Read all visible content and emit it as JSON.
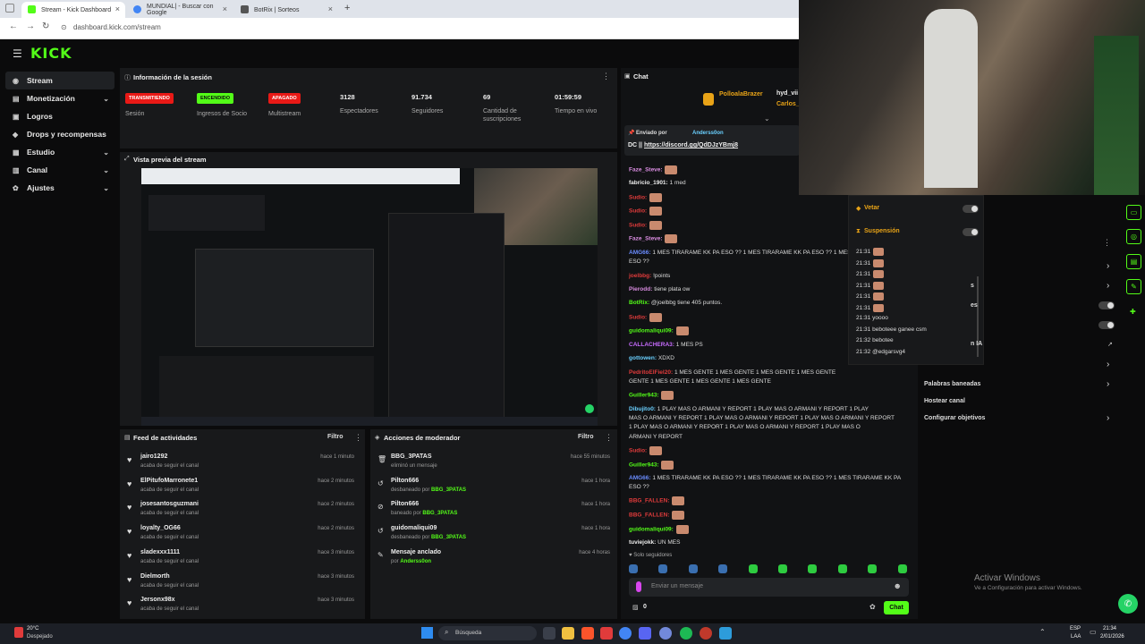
{
  "browser": {
    "tabs": [
      {
        "title": "Stream - Kick Dashboard",
        "color": "#53fc18"
      },
      {
        "title": "MUNDIAL| - Buscar con Google",
        "color": "#4285f4"
      },
      {
        "title": "BotRix | Sorteos",
        "color": "#888888"
      }
    ],
    "url": "dashboard.kick.com/stream"
  },
  "app": {
    "logo": "KICK",
    "sidebar": [
      {
        "label": "Stream",
        "icon": "radio-icon",
        "active": true
      },
      {
        "label": "Monetización",
        "icon": "money-icon",
        "chevron": true
      },
      {
        "label": "Logros",
        "icon": "trophy-icon"
      },
      {
        "label": "Drops y recompensas",
        "icon": "gift-icon"
      },
      {
        "label": "Estudio",
        "icon": "studio-icon",
        "chevron": true
      },
      {
        "label": "Canal",
        "icon": "channel-icon",
        "chevron": true
      },
      {
        "label": "Ajustes",
        "icon": "gear-icon",
        "chevron": true
      }
    ]
  },
  "session": {
    "title": "Información de la sesión",
    "stats": [
      {
        "badge": "TRANSMITIENDO",
        "badge_color": "#e91916",
        "label": "Sesión"
      },
      {
        "badge": "ENCENDIDO",
        "badge_color": "#53fc18",
        "label": "Ingresos de Socio"
      },
      {
        "badge": "APAGADO",
        "badge_color": "#e91916",
        "label": "Multistream"
      },
      {
        "value": "3128",
        "label": "Espectadores"
      },
      {
        "value": "91.734",
        "label": "Seguidores"
      },
      {
        "value": "69",
        "label": "Cantidad de suscripciones"
      },
      {
        "value": "01:59:59",
        "label": "Tiempo en vivo"
      }
    ]
  },
  "preview": {
    "title": "Vista previa del stream"
  },
  "feed": {
    "title": "Feed de actividades",
    "filter": "Filtro",
    "items": [
      {
        "user": "jairo1292",
        "sub": "acaba de seguir el canal",
        "time": "hace 1 minuto"
      },
      {
        "user": "ElPitufoMarronete1",
        "sub": "acaba de seguir el canal",
        "time": "hace 2 minutos"
      },
      {
        "user": "josesantosguzmani",
        "sub": "acaba de seguir el canal",
        "time": "hace 2 minutos"
      },
      {
        "user": "loyalty_OG66",
        "sub": "acaba de seguir el canal",
        "time": "hace 2 minutos"
      },
      {
        "user": "sladexxx1111",
        "sub": "acaba de seguir el canal",
        "time": "hace 3 minutos"
      },
      {
        "user": "Dielmorth",
        "sub": "acaba de seguir el canal",
        "time": "hace 3 minutos"
      },
      {
        "user": "Jersonx98x",
        "sub": "acaba de seguir el canal",
        "time": "hace 3 minutos"
      }
    ]
  },
  "modactions": {
    "title": "Acciones de moderador",
    "filter": "Filtro",
    "items": [
      {
        "user": "BBG_3PATAS",
        "sub": "eliminó un mensaje",
        "by": "",
        "time": "hace 55 minutos",
        "icon": "trash-icon"
      },
      {
        "user": "Pilton666",
        "sub": "desbaneado por",
        "by": "BBG_3PATAS",
        "time": "hace 1 hora",
        "icon": "undo-icon"
      },
      {
        "user": "Pilton666",
        "sub": "baneado por",
        "by": "BBG_3PATAS",
        "time": "hace 1 hora",
        "icon": "ban-icon"
      },
      {
        "user": "guidomaliqui09",
        "sub": "desbaneado por",
        "by": "BBG_3PATAS",
        "time": "hace 1 hora",
        "icon": "undo-icon"
      },
      {
        "user": "Mensaje anclado",
        "sub": "por",
        "by": "Anderss0on",
        "time": "hace 4 horas",
        "icon": "pin-icon"
      }
    ]
  },
  "chat": {
    "title": "Chat",
    "top_users": [
      "PolloalaBrazer",
      "hyd_vii",
      "Carlos_"
    ],
    "pinned_by_prefix": "Enviado por",
    "pinned_by": "Anderss0on",
    "pinned_text": "DC ||",
    "pinned_link": "https://discord.gg/QdDJzYBmj8",
    "messages": [
      {
        "user": "Faze_Steve:",
        "color": "#d98ce0",
        "text": ""
      },
      {
        "user": "fabricio_1901:",
        "color": "#eeeeee",
        "text": "1 med"
      },
      {
        "user": "Sudio:",
        "color": "#e03b3b",
        "text": ""
      },
      {
        "user": "Sudio:",
        "color": "#e03b3b",
        "text": ""
      },
      {
        "user": "Sudio:",
        "color": "#e03b3b",
        "text": ""
      },
      {
        "user": "Faze_Steve:",
        "color": "#d98ce0",
        "text": ""
      },
      {
        "user": "AMG66:",
        "color": "#6a8cff",
        "text": "1 MES TIRARAME KK PA ESO ?? 1 MES TIRARAME KK PA ESO ?? 1 MES TIRARAME KK PA"
      },
      {
        "user": "",
        "color": "#dddddd",
        "text": "ESO ??"
      },
      {
        "user": "joelbbg:",
        "color": "#e03b3b",
        "text": "!points"
      },
      {
        "user": "Pierodd:",
        "color": "#d98ce0",
        "text": "tiene plata ow"
      },
      {
        "user": "BotRix:",
        "color": "#53fc18",
        "text": "@joelbbg tiene 405 puntos."
      },
      {
        "user": "Sudio:",
        "color": "#e03b3b",
        "text": ""
      },
      {
        "user": "guidomaliqui09:",
        "color": "#53fc18",
        "text": ""
      },
      {
        "user": "CALLACHERA3:",
        "color": "#c86cff",
        "text": "1 MES PS"
      },
      {
        "user": "gottowen:",
        "color": "#6ad0ff",
        "text": "XDXD"
      },
      {
        "user": "PedritoElFiel20:",
        "color": "#e03b3b",
        "text": "1 MES GENTE    1 MES GENTE    1 MES GENTE    1 MES GENTE"
      },
      {
        "user": "",
        "color": "#dddddd",
        "text": "GENTE    1 MES GENTE    1 MES GENTE    1 MES GENTE"
      },
      {
        "user": "Guiller943:",
        "color": "#53fc18",
        "text": ""
      },
      {
        "user": "Dibujito0:",
        "color": "#6ad0ff",
        "text": "1 PLAY MAS O ARMANI Y REPORT    1 PLAY MAS O ARMANI Y REPORT    1 PLAY"
      },
      {
        "user": "",
        "color": "#dddddd",
        "text": "MAS O ARMANI Y REPORT    1 PLAY MAS O ARMANI Y REPORT    1 PLAY MAS O ARMANI Y REPORT"
      },
      {
        "user": "",
        "color": "#dddddd",
        "text": "    1 PLAY MAS O ARMANI Y REPORT    1 PLAY MAS O ARMANI Y REPORT    1 PLAY MAS O"
      },
      {
        "user": "",
        "color": "#dddddd",
        "text": "ARMANI Y REPORT"
      },
      {
        "user": "Sudio:",
        "color": "#e03b3b",
        "text": ""
      },
      {
        "user": "Guiller943:",
        "color": "#53fc18",
        "text": ""
      },
      {
        "user": "AMG66:",
        "color": "#6a8cff",
        "text": "1 MES TIRARAME KK PA ESO ?? 1 MES TIRARAME KK PA ESO ?? 1 MES TIRARAME KK PA"
      },
      {
        "user": "",
        "color": "#dddddd",
        "text": "ESO ??"
      },
      {
        "user": "BBG_FALLEN:",
        "color": "#e03b3b",
        "text": ""
      },
      {
        "user": "BBG_FALLEN:",
        "color": "#e03b3b",
        "text": ""
      },
      {
        "user": "guidomaliqui09:",
        "color": "#53fc18",
        "text": ""
      },
      {
        "user": "tuviejokk:",
        "color": "#eeeeee",
        "text": "UN MES"
      }
    ],
    "followers_only": "Solo seguidores",
    "input_placeholder": "Enviar un mensaje",
    "points": "0",
    "send_label": "Chat"
  },
  "modpanel": {
    "vetar": "Vetar",
    "suspension": "Suspensión",
    "log": [
      {
        "time": "21:31",
        "text": ""
      },
      {
        "time": "21:31",
        "text": ""
      },
      {
        "time": "21:31",
        "text": ""
      },
      {
        "time": "21:31",
        "text": ""
      },
      {
        "time": "21:31",
        "text": ""
      },
      {
        "time": "21:31",
        "text": ""
      },
      {
        "time": "21:31",
        "text": "yoooo"
      },
      {
        "time": "21:31",
        "text": "beboteee ganee csm"
      },
      {
        "time": "21:32",
        "text": "bebotee"
      },
      {
        "time": "21:32",
        "text": "@edgarsvg4"
      }
    ]
  },
  "settings_menu": {
    "items": [
      "s",
      "es",
      "n IA",
      "Palabras baneadas",
      "Hostear canal",
      "Configurar objetivos"
    ]
  },
  "windows": {
    "activate_title": "Activar Windows",
    "activate_sub": "Ve a Configuración para activar Windows.",
    "weather_temp": "20°C",
    "weather_desc": "Despejado",
    "search": "Búsqueda",
    "lang": "ESP",
    "lang2": "LAA",
    "time": "21:34",
    "date": "2/01/2026"
  }
}
